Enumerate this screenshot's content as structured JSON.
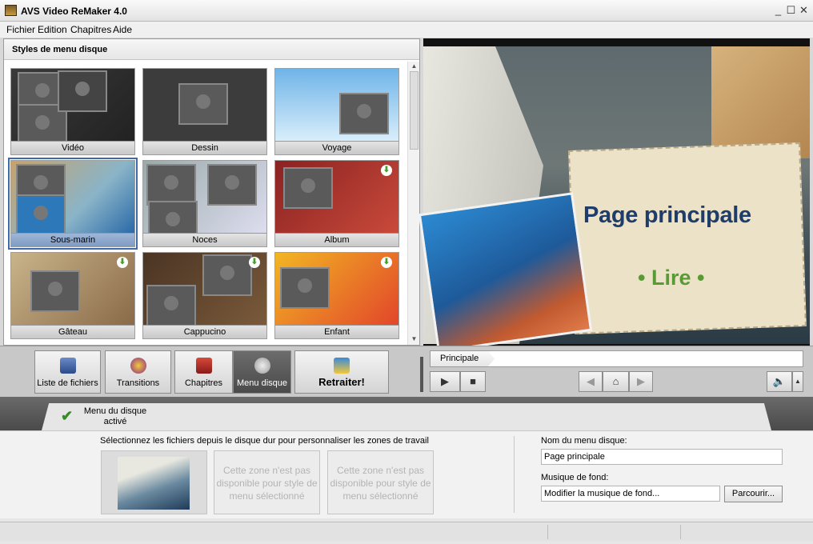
{
  "app": {
    "title": "AVS Video ReMaker 4.0"
  },
  "window": {
    "minimize": "_",
    "maximize": "☐",
    "close": "✕"
  },
  "menu": [
    "Fichier",
    "Edition",
    "Chapitres",
    "Aide"
  ],
  "styles_panel": {
    "header": "Styles de menu disque",
    "tiles": [
      {
        "label": "Vidéo",
        "download": false
      },
      {
        "label": "Dessin",
        "download": false
      },
      {
        "label": "Voyage",
        "download": false
      },
      {
        "label": "Sous-marin",
        "download": false,
        "selected": true
      },
      {
        "label": "Noces",
        "download": false
      },
      {
        "label": "Album",
        "download": true
      },
      {
        "label": "Gâteau",
        "download": true
      },
      {
        "label": "Cappucino",
        "download": true
      },
      {
        "label": "Enfant",
        "download": true
      }
    ]
  },
  "preview": {
    "title": "Page principale",
    "play": "• Lire •"
  },
  "toolbar": {
    "files": "Liste de fichiers",
    "transitions": "Transitions",
    "chapters": "Chapitres",
    "disc_menu": "Menu disque",
    "redo": "Retraiter!"
  },
  "player": {
    "chapter": "Principale"
  },
  "tab": {
    "label": "Menu du disque activé"
  },
  "content": {
    "instruction": "Sélectionnez les fichiers depuis le disque dur pour personnaliser les zones de travail",
    "slot_unavailable": "Cette zone n'est pas disponible pour style de menu sélectionné",
    "menu_name_label": "Nom du menu disque:",
    "menu_name_value": "Page principale",
    "music_label": "Musique de fond:",
    "music_value": "Modifier la musique de fond...",
    "browse": "Parcourir..."
  },
  "colors": {
    "accent": "#3d6aa8",
    "preview_title": "#1e3d6a",
    "preview_play": "#5a9a35"
  }
}
